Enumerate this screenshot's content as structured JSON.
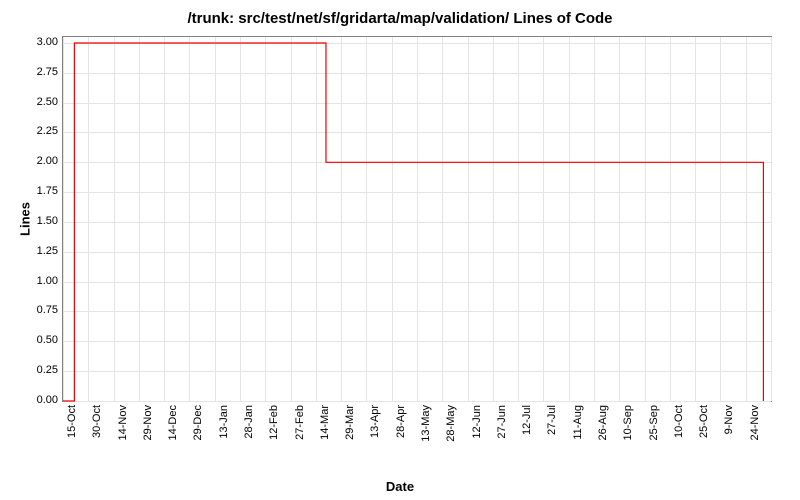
{
  "chart_data": {
    "type": "line",
    "title": "/trunk: src/test/net/sf/gridarta/map/validation/ Lines of Code",
    "xlabel": "Date",
    "ylabel": "Lines",
    "ylim": [
      0,
      3.05
    ],
    "y_ticks": [
      0,
      0.25,
      0.5,
      0.75,
      1.0,
      1.25,
      1.5,
      1.75,
      2.0,
      2.25,
      2.5,
      2.75,
      3.0
    ],
    "y_tick_labels": [
      "0.00",
      "0.25",
      "0.50",
      "0.75",
      "1.00",
      "1.25",
      "1.50",
      "1.75",
      "2.00",
      "2.25",
      "2.50",
      "2.75",
      "3.00"
    ],
    "x_ticks": [
      0,
      1,
      2,
      3,
      4,
      5,
      6,
      7,
      8,
      9,
      10,
      11,
      12,
      13,
      14,
      15,
      16,
      17,
      18,
      19,
      20,
      21,
      22,
      23,
      24,
      25,
      26,
      27,
      28
    ],
    "x_tick_labels": [
      "15-Oct",
      "30-Oct",
      "14-Nov",
      "29-Nov",
      "14-Dec",
      "29-Dec",
      "13-Jan",
      "28-Jan",
      "12-Feb",
      "27-Feb",
      "14-Mar",
      "29-Mar",
      "13-Apr",
      "28-Apr",
      "13-May",
      "28-May",
      "12-Jun",
      "27-Jun",
      "12-Jul",
      "27-Jul",
      "11-Aug",
      "26-Aug",
      "10-Sep",
      "25-Sep",
      "10-Oct",
      "25-Oct",
      "9-Nov",
      "24-Nov",
      ""
    ],
    "series": [
      {
        "name": "Lines",
        "color": "#ee0000",
        "points": [
          {
            "x": 0,
            "y": 0
          },
          {
            "x": 0.45,
            "y": 0
          },
          {
            "x": 0.45,
            "y": 3
          },
          {
            "x": 10.4,
            "y": 3
          },
          {
            "x": 10.4,
            "y": 2
          },
          {
            "x": 27.7,
            "y": 2
          },
          {
            "x": 27.7,
            "y": 0
          }
        ]
      }
    ]
  }
}
